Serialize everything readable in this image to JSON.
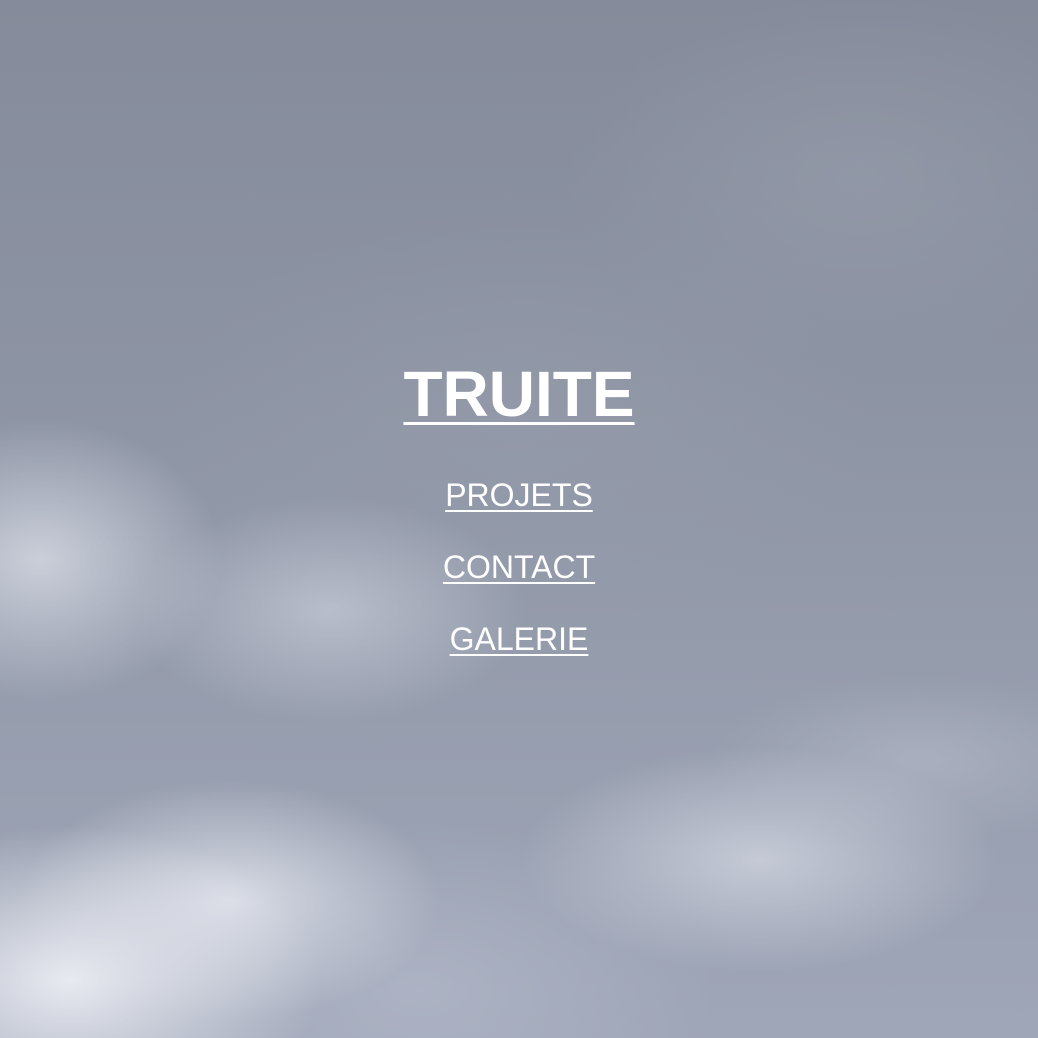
{
  "site": {
    "title": "TRUITE"
  },
  "nav": {
    "items": [
      {
        "label": "PROJETS"
      },
      {
        "label": "CONTACT"
      },
      {
        "label": "GALERIE"
      }
    ]
  },
  "colors": {
    "text": "#ffffff",
    "sky_dark": "#858b9a",
    "sky_light": "#e4e7ee"
  }
}
